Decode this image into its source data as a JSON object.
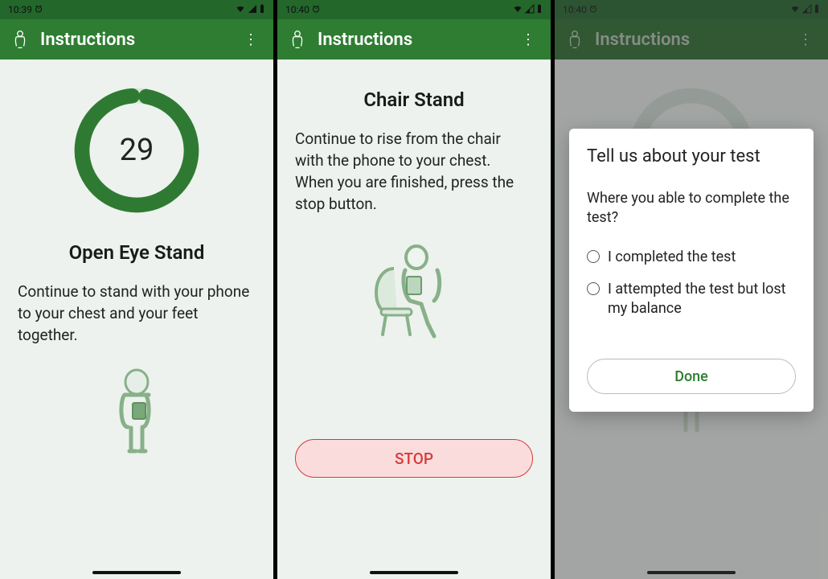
{
  "shared": {
    "appbar_title": "Instructions",
    "overflow_label": "⋮"
  },
  "screen1": {
    "time": "10:39",
    "ring_value": "29",
    "title": "Open Eye Stand",
    "body": "Continue to stand with your phone to your chest and your feet together."
  },
  "screen2": {
    "time": "10:40",
    "title": "Chair Stand",
    "body": "Continue to rise from the chair with the phone to your chest. When you are finished, press the stop button.",
    "stop_label": "STOP"
  },
  "screen3": {
    "time": "10:40",
    "modal_title": "Tell us about your test",
    "modal_question": "Where you able to complete the test?",
    "option1": "I completed the test",
    "option2": "I attempted the test but lost my balance",
    "done_label": "Done"
  },
  "colors": {
    "brand_green": "#2e7d32",
    "ring_green": "#2f7a33",
    "stop_red": "#d63b3b"
  }
}
